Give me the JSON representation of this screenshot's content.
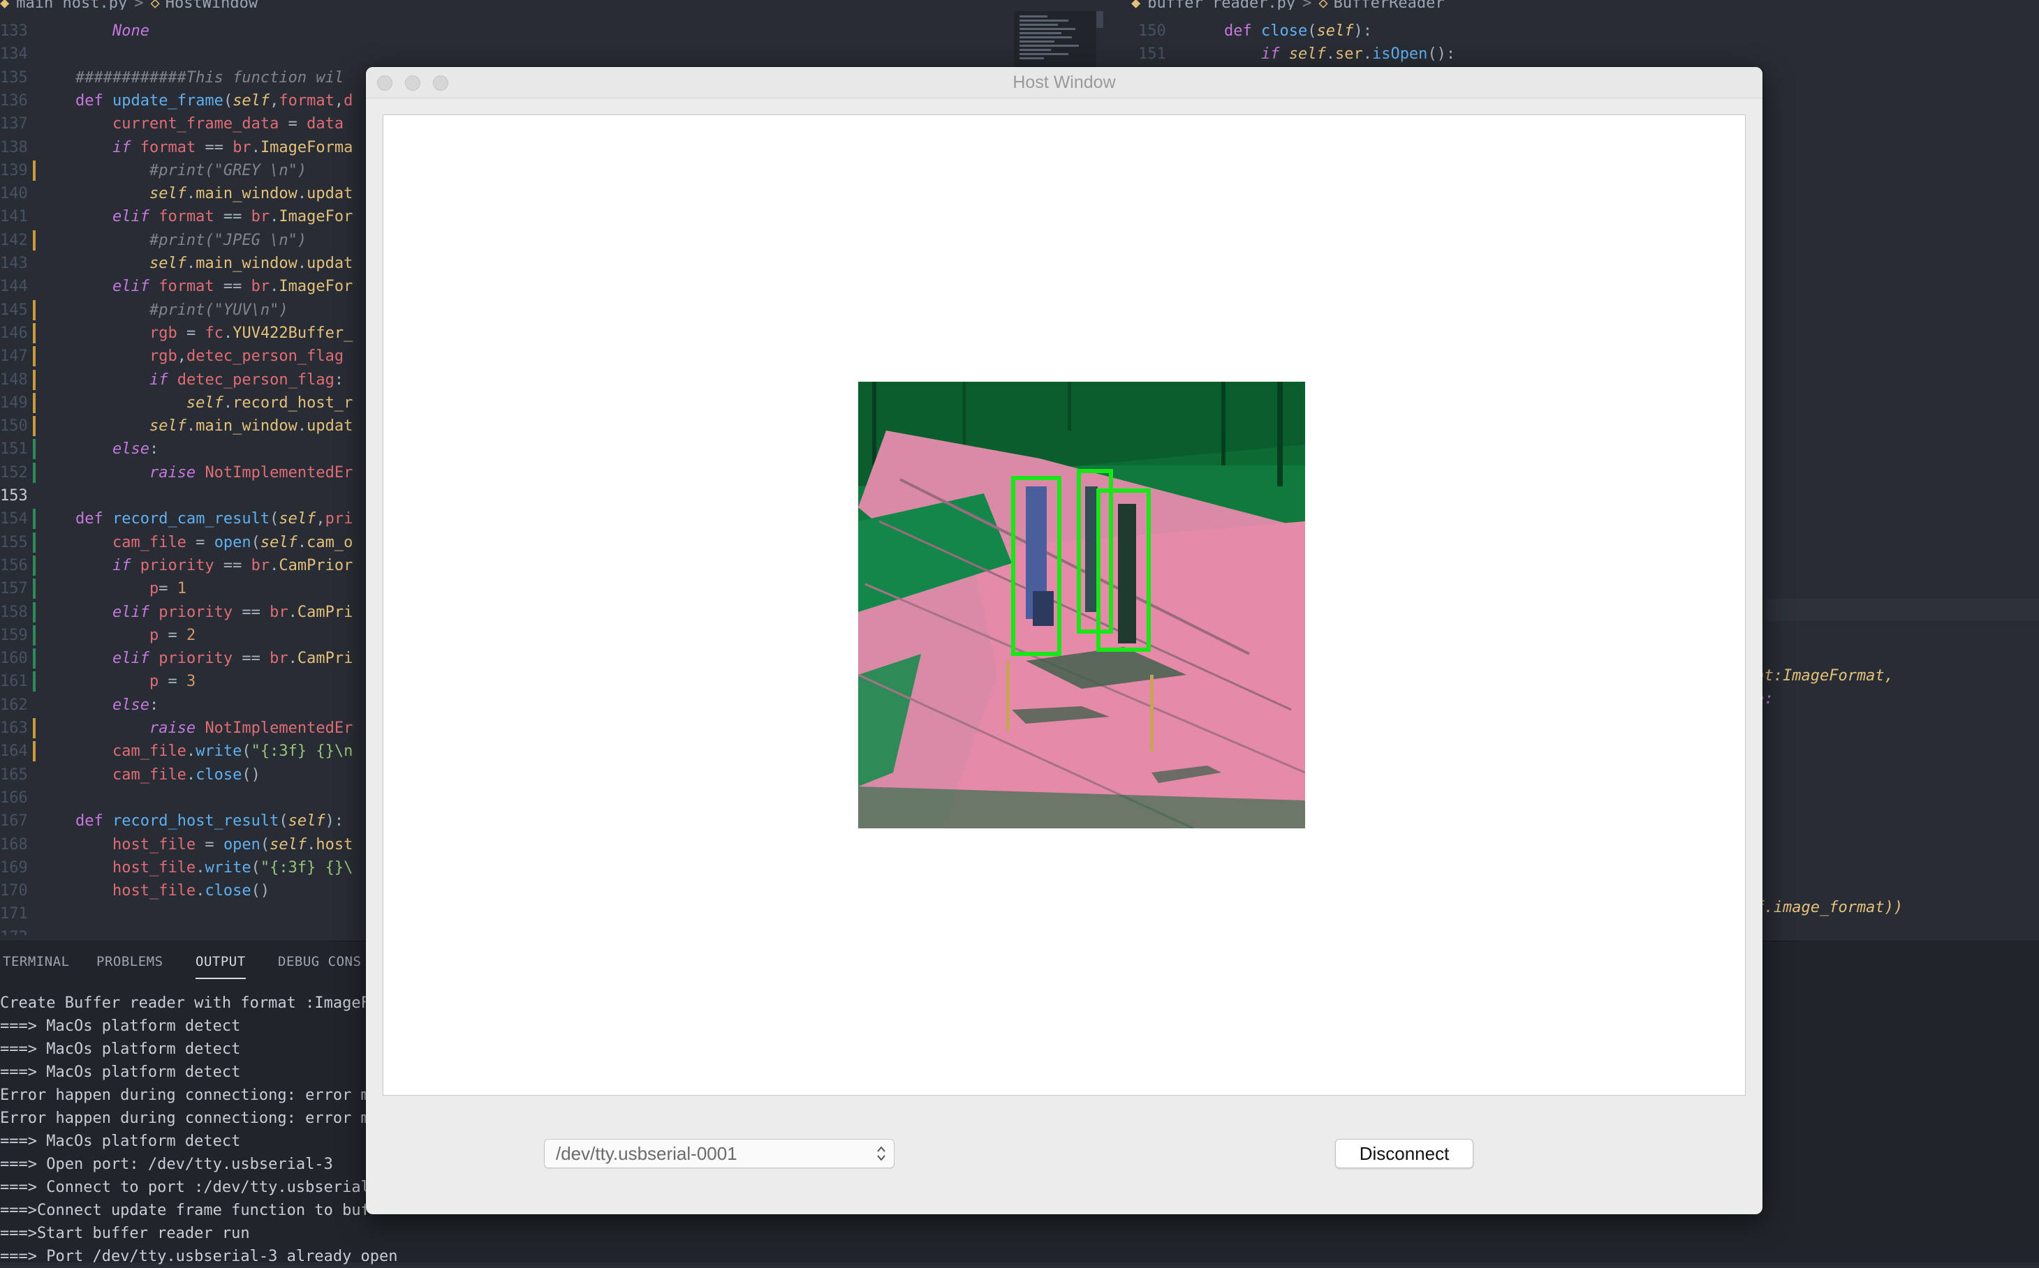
{
  "left_tab": {
    "file": "main_host.py",
    "symbol": "HostWindow"
  },
  "right_tab": {
    "file": "buffer_reader.py",
    "symbol": "BufferReader"
  },
  "left_code": [
    {
      "n": "133",
      "code": "        None"
    },
    {
      "n": "134",
      "code": ""
    },
    {
      "n": "135",
      "code": "    ############This function wil"
    },
    {
      "n": "136",
      "code": "    def update_frame(self,format,d"
    },
    {
      "n": "137",
      "code": "        current_frame_data = data"
    },
    {
      "n": "138",
      "code": "        if format == br.ImageForma"
    },
    {
      "n": "139",
      "code": "            #print(\"GREY \\n\")"
    },
    {
      "n": "140",
      "code": "            self.main_window.updat"
    },
    {
      "n": "141",
      "code": "        elif format == br.ImageFor"
    },
    {
      "n": "142",
      "code": "            #print(\"JPEG \\n\")"
    },
    {
      "n": "143",
      "code": "            self.main_window.updat"
    },
    {
      "n": "144",
      "code": "        elif format == br.ImageFor"
    },
    {
      "n": "145",
      "code": "            #print(\"YUV\\n\")"
    },
    {
      "n": "146",
      "code": "            rgb = fc.YUV422Buffer_"
    },
    {
      "n": "147",
      "code": "            rgb,detec_person_flag "
    },
    {
      "n": "148",
      "code": "            if detec_person_flag:"
    },
    {
      "n": "149",
      "code": "                self.record_host_r"
    },
    {
      "n": "150",
      "code": "            self.main_window.updat"
    },
    {
      "n": "151",
      "code": "        else:"
    },
    {
      "n": "152",
      "code": "            raise NotImplementedEr"
    },
    {
      "n": "153",
      "code": ""
    },
    {
      "n": "154",
      "code": "    def record_cam_result(self,pri"
    },
    {
      "n": "155",
      "code": "        cam_file = open(self.cam_o"
    },
    {
      "n": "156",
      "code": "        if priority == br.CamPrior"
    },
    {
      "n": "157",
      "code": "            p= 1"
    },
    {
      "n": "158",
      "code": "        elif priority == br.CamPri"
    },
    {
      "n": "159",
      "code": "            p = 2"
    },
    {
      "n": "160",
      "code": "        elif priority == br.CamPri"
    },
    {
      "n": "161",
      "code": "            p = 3"
    },
    {
      "n": "162",
      "code": "        else:"
    },
    {
      "n": "163",
      "code": "            raise NotImplementedEr"
    },
    {
      "n": "164",
      "code": "        cam_file.write(\"{:3f} {}\\n"
    },
    {
      "n": "165",
      "code": "        cam_file.close()"
    },
    {
      "n": "166",
      "code": ""
    },
    {
      "n": "167",
      "code": "    def record_host_result(self):"
    },
    {
      "n": "168",
      "code": "        host_file = open(self.host"
    },
    {
      "n": "169",
      "code": "        host_file.write(\"{:3f} {}\\"
    },
    {
      "n": "170",
      "code": "        host_file.close()"
    },
    {
      "n": "171",
      "code": ""
    },
    {
      "n": "172",
      "code": ""
    }
  ],
  "right_code": [
    {
      "n": "150",
      "code": "    def close(self):"
    },
    {
      "n": "151",
      "code": "        if self.ser.isOpen():"
    }
  ],
  "right_fragments": {
    "frag1": "mat:ImageFormat,",
    "frag2": "ne:",
    "frag3": "lf.image_format))"
  },
  "panel": {
    "tabs": [
      "TERMINAL",
      "PROBLEMS",
      "OUTPUT",
      "DEBUG CONS"
    ],
    "active_tab": "OUTPUT",
    "output_lines": [
      "Create Buffer reader with format :ImageF",
      "===> MacOs platform detect",
      "===> MacOs platform detect",
      "===> MacOs platform detect",
      "Error happen during connectiong: error m",
      "Error happen during connectiong: error m",
      "===> MacOs platform detect",
      "===> Open port: /dev/tty.usbserial-3",
      "===> Connect to port :/dev/tty.usbserial",
      "===>Connect update frame function to buf",
      "===>Start buffer reader run",
      "===> Port /dev/tty.usbserial-3 already open"
    ]
  },
  "host_window": {
    "title": "Host Window",
    "port_value": "/dev/tty.usbserial-0001",
    "disconnect_label": "Disconnect"
  },
  "colors": {
    "editor_bg": "#282c34",
    "panel_bg": "#21252b",
    "frame_green": "#0f7a3c",
    "frame_pink": "#e58aa8",
    "detection_box": "#19e619"
  }
}
